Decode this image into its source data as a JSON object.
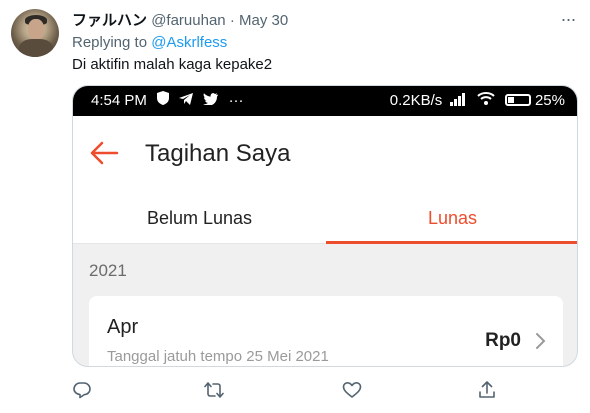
{
  "tweet": {
    "display_name": "ファルハン",
    "handle": "@faruuhan",
    "separator": "·",
    "date": "May 30",
    "reply_prefix": "Replying to",
    "reply_mention": "@Askrlfess",
    "text": "Di aktifin malah kaga kepake2"
  },
  "media": {
    "status_bar": {
      "time": "4:54 PM",
      "more": "···",
      "speed": "0.2KB/s",
      "battery": "25%"
    },
    "app": {
      "title": "Tagihan Saya",
      "tabs": [
        {
          "label": "Belum Lunas",
          "active": false
        },
        {
          "label": "Lunas",
          "active": true
        }
      ],
      "year": "2021",
      "bill": {
        "month": "Apr",
        "due": "Tanggal jatuh tempo 25 Mei 2021",
        "amount": "Rp0"
      }
    }
  },
  "colors": {
    "accent": "#ee4d2d",
    "link": "#1d9bf0",
    "muted": "#536471"
  },
  "icons": [
    "more-icon",
    "back-arrow-icon",
    "chevron-right-icon",
    "reply-icon",
    "retweet-icon",
    "like-icon",
    "share-icon"
  ]
}
